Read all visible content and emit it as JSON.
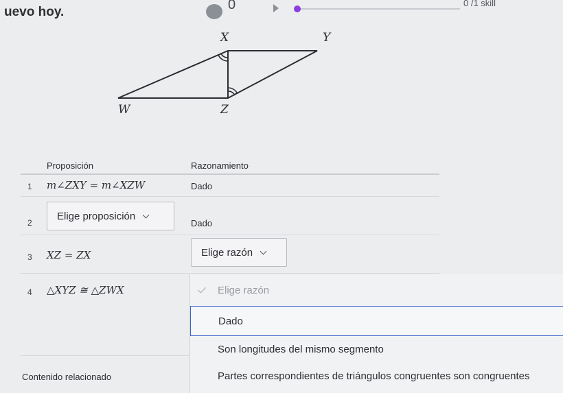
{
  "header": {
    "title": "uevo hoy.",
    "progress_count": "0",
    "skill_label": "0 /1 skill",
    "accent_color": "#8a3ee0"
  },
  "diagram": {
    "vertices": {
      "x": "X",
      "y": "Y",
      "w": "W",
      "z": "Z"
    }
  },
  "table": {
    "headers": {
      "proposition": "Proposición",
      "reasoning": "Razonamiento"
    },
    "rows": [
      {
        "num": "1",
        "statement": "m∠ZXY = m∠XZW",
        "reason": "Dado"
      },
      {
        "num": "2",
        "statement_select": "Elige proposición",
        "reason": "Dado"
      },
      {
        "num": "3",
        "statement": "XZ = ZX",
        "reason_select": "Elige razón"
      },
      {
        "num": "4",
        "statement": "△XYZ ≅ △ZWX"
      }
    ]
  },
  "dropdown": {
    "placeholder": "Elige razón",
    "options": [
      "Dado",
      "Son longitudes del mismo segmento",
      "Partes correspondientes de triángulos congruentes son congruentes"
    ],
    "focus_color": "#3e63c8"
  },
  "footer": {
    "related": "Contenido relacionado"
  }
}
